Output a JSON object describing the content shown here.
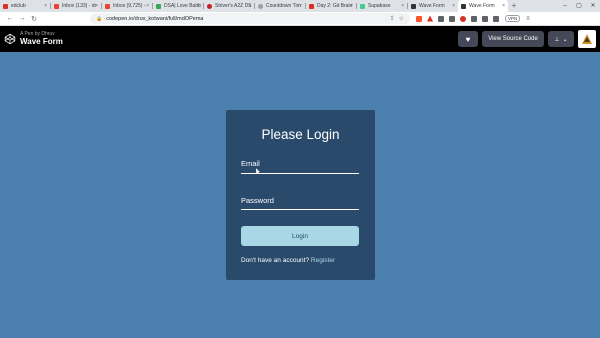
{
  "browser": {
    "tabs": [
      {
        "label": "edclub",
        "color": "#d93025"
      },
      {
        "label": "Inbox (133) - dr",
        "color": "#ea4335"
      },
      {
        "label": "Inbox (9,725) -",
        "color": "#ea4335"
      },
      {
        "label": "DSA| Love Babb",
        "color": "#34a853"
      },
      {
        "label": "Striver's A2Z DS",
        "color": "#c5221f"
      },
      {
        "label": "Countdown Tim",
        "color": "#9aa0a6"
      },
      {
        "label": "Day 2: Git Brain",
        "color": "#d93025"
      },
      {
        "label": "Supabase",
        "color": "#3ecf8e"
      },
      {
        "label": "Wave Form",
        "color": "#333333"
      },
      {
        "label": "Wave Form",
        "color": "#333333",
        "active": true
      }
    ],
    "new_tab_label": "+",
    "url": "codepen.io/druv_kotwani/full/mdOPema",
    "vpn_label": "VPN"
  },
  "codepen": {
    "by_line": "A Pen by Dhruv",
    "pen_title": "Wave Form",
    "heart_icon": "♥",
    "view_source_label": "View Source Code",
    "pin_icon": "📌",
    "chevron_icon": "⌄"
  },
  "login": {
    "title": "Please Login",
    "email_label": "Email",
    "password_label": "Password",
    "button_label": "Login",
    "no_account_text": "Don't have an account?",
    "register_link": "Register"
  },
  "colors": {
    "page_bg": "#4a7fae",
    "card_bg": "#2a4a6b",
    "button_bg": "#a8d8e6"
  }
}
